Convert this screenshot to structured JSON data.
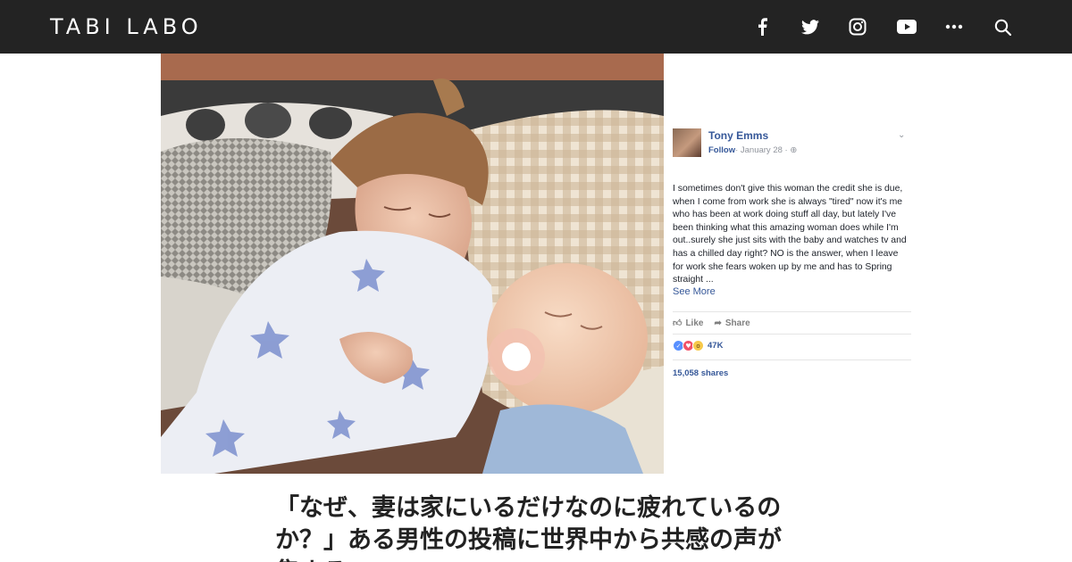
{
  "header": {
    "logo": "TABI LABO",
    "icons": [
      "facebook-icon",
      "twitter-icon",
      "instagram-icon",
      "youtube-icon",
      "more-icon",
      "search-icon"
    ]
  },
  "hero": {
    "photo_description_icon": "photo-image",
    "facebook_post": {
      "author": "Tony Emms",
      "follow": "Follow",
      "date": "· January 28 · ",
      "body": "I sometimes don't give this woman the credit she is due, when I come from work she is always \"tired\" now it's me who has been at work doing stuff all day, but lately I've been thinking what this amazing woman does while I'm out..surely she just sits with the baby and watches tv and has a chilled day right? NO is the answer, when I leave for work she fears woken up by me and has to Spring straight ...",
      "see_more": "See More",
      "like_label": "Like",
      "share_label": "Share",
      "reaction_count": "47K",
      "shares": "15,058 shares"
    }
  },
  "article": {
    "title": "「なぜ、妻は家にいるだけなのに疲れているのか？」ある男性の投稿に世界中から共感の声が集まる"
  },
  "colors": {
    "header_bg": "#232323",
    "fb_link": "#365899"
  }
}
